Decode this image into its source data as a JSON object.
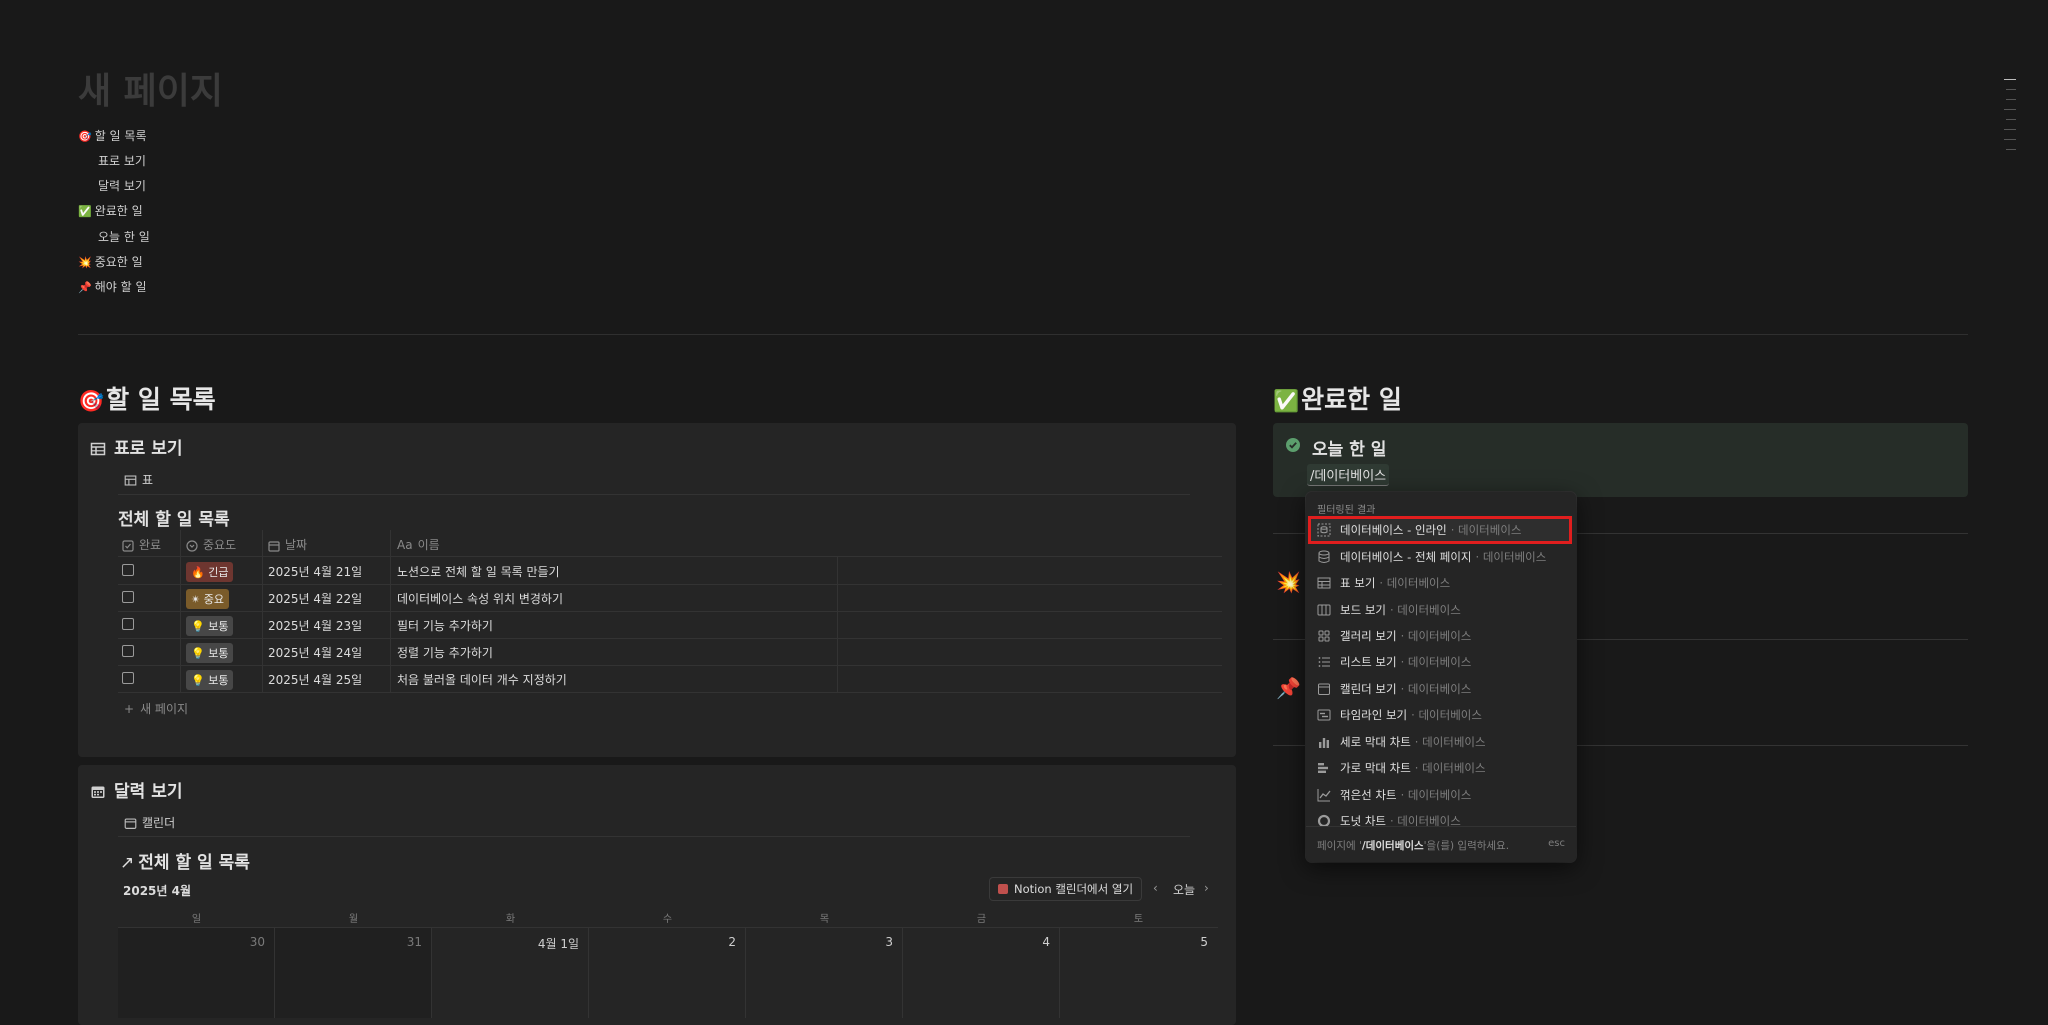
{
  "page": {
    "title": "새 페이지"
  },
  "toc": [
    {
      "emoji": "🎯",
      "label": "할 일 목록"
    },
    {
      "emoji": "",
      "label": "표로 보기"
    },
    {
      "emoji": "",
      "label": "달력 보기"
    },
    {
      "emoji": "✅",
      "label": "완료한 일"
    },
    {
      "emoji": "",
      "label": "오늘 한 일"
    },
    {
      "emoji": "💥",
      "label": "중요한 일"
    },
    {
      "emoji": "📌",
      "label": "해야 할 일"
    }
  ],
  "todo_section": {
    "emoji": "🎯",
    "title": "할 일 목록"
  },
  "table_block": {
    "title": "표로 보기",
    "view_tab": "표",
    "db_title": "전체 할 일 목록",
    "columns": [
      "완료",
      "중요도",
      "날짜",
      "이름"
    ],
    "name_col_prefix": "Aa",
    "rows": [
      {
        "priority_emoji": "🔥",
        "priority": "긴급",
        "color": "#6e3630",
        "date": "2025년 4월 21일",
        "name": "노션으로 전체 할 일 목록 만들기"
      },
      {
        "priority_emoji": "✴",
        "priority": "중요",
        "color": "#7a5b2a",
        "date": "2025년 4월 22일",
        "name": "데이터베이스 속성 위치 변경하기"
      },
      {
        "priority_emoji": "💡",
        "priority": "보통",
        "color": "#474747",
        "date": "2025년 4월 23일",
        "name": "필터 기능 추가하기"
      },
      {
        "priority_emoji": "💡",
        "priority": "보통",
        "color": "#474747",
        "date": "2025년 4월 24일",
        "name": "정렬 기능 추가하기"
      },
      {
        "priority_emoji": "💡",
        "priority": "보통",
        "color": "#474747",
        "date": "2025년 4월 25일",
        "name": "처음 불러올 데이터 개수 지정하기"
      }
    ],
    "new_page": "새 페이지"
  },
  "calendar_block": {
    "title": "달력 보기",
    "view_tab": "캘린더",
    "db_title": "전체 할 일 목록",
    "month": "2025년 4월",
    "open_button": "Notion 캘린더에서 열기",
    "today": "오늘",
    "weekdays": [
      "일",
      "월",
      "화",
      "수",
      "목",
      "금",
      "토"
    ],
    "days": [
      "30",
      "31",
      "4월 1일",
      "2",
      "3",
      "4",
      "5"
    ]
  },
  "done_section": {
    "emoji": "✅",
    "title": "완료한 일"
  },
  "today_block": {
    "title": "오늘 한 일",
    "input": "/데이터베이스"
  },
  "side_emojis": [
    "💥",
    "📌"
  ],
  "popup": {
    "header": "필터링된 결과",
    "items": [
      {
        "icon": "database-inline-icon",
        "label": "데이터베이스 - 인라인",
        "category": "데이터베이스"
      },
      {
        "icon": "database-full-icon",
        "label": "데이터베이스 - 전체 페이지",
        "category": "데이터베이스"
      },
      {
        "icon": "table-icon",
        "label": "표 보기",
        "category": "데이터베이스"
      },
      {
        "icon": "board-icon",
        "label": "보드 보기",
        "category": "데이터베이스"
      },
      {
        "icon": "gallery-icon",
        "label": "갤러리 보기",
        "category": "데이터베이스"
      },
      {
        "icon": "list-icon",
        "label": "리스트 보기",
        "category": "데이터베이스"
      },
      {
        "icon": "calendar-icon",
        "label": "캘린더 보기",
        "category": "데이터베이스"
      },
      {
        "icon": "timeline-icon",
        "label": "타임라인 보기",
        "category": "데이터베이스"
      },
      {
        "icon": "vertical-bar-chart-icon",
        "label": "세로 막대 차트",
        "category": "데이터베이스"
      },
      {
        "icon": "horizontal-bar-chart-icon",
        "label": "가로 막대 차트",
        "category": "데이터베이스"
      },
      {
        "icon": "line-chart-icon",
        "label": "꺾은선 차트",
        "category": "데이터베이스"
      },
      {
        "icon": "donut-chart-icon",
        "label": "도넛 차트",
        "category": "데이터베이스"
      }
    ],
    "footer_prefix": "페이지에",
    "footer_query": "/데이터베이스",
    "footer_suffix": "'을(를) 입력하세요.",
    "esc": "esc"
  },
  "highlight_color": "#e01e1e"
}
